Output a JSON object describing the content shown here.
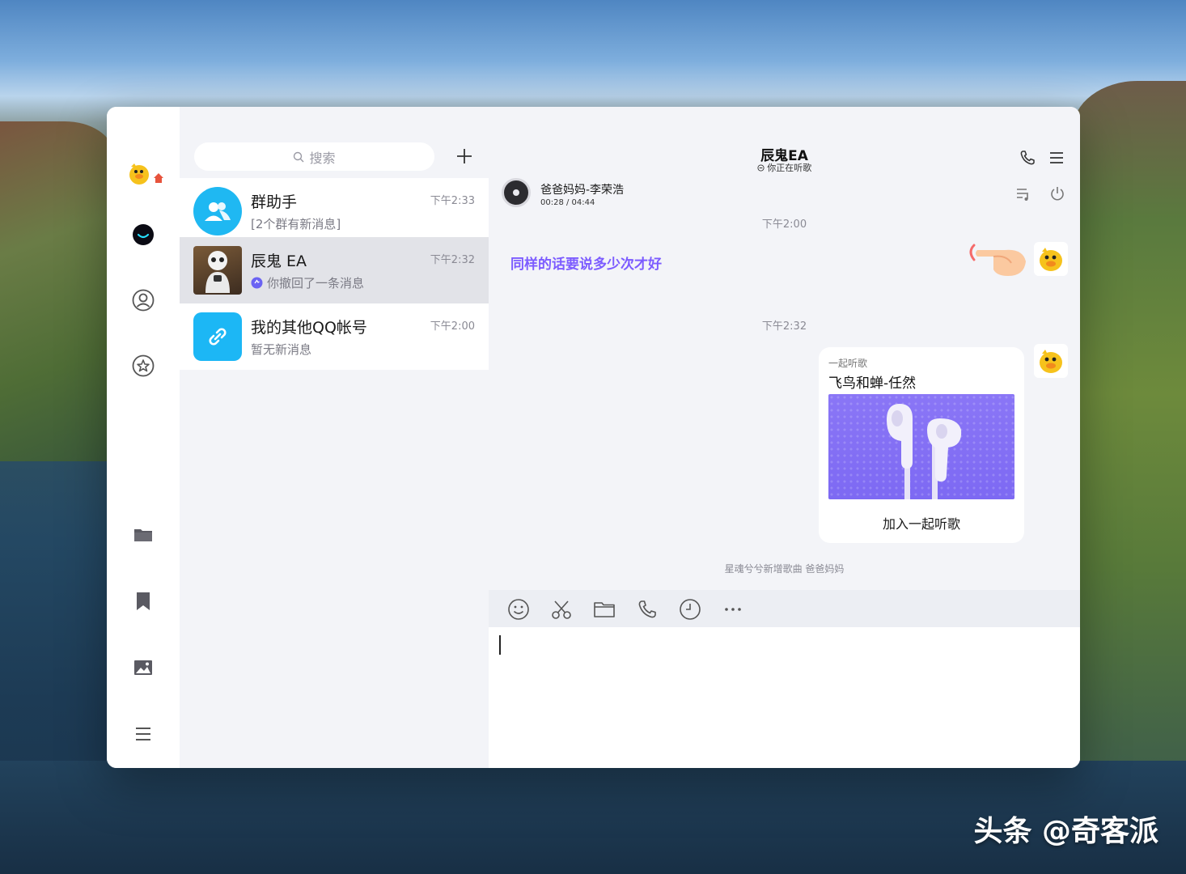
{
  "watermark": "头条 @奇客派",
  "sidebar": {
    "items": [
      {
        "name": "qq-avatar"
      },
      {
        "name": "messages"
      },
      {
        "name": "contacts"
      },
      {
        "name": "discover"
      },
      {
        "name": "files"
      },
      {
        "name": "favorites"
      },
      {
        "name": "photos"
      },
      {
        "name": "menu"
      }
    ]
  },
  "search": {
    "placeholder": "搜索"
  },
  "chats": [
    {
      "name": "群助手",
      "preview": "[2个群有新消息]",
      "time": "下午2:33",
      "avatar_color": "#1fb8f2"
    },
    {
      "name": "辰鬼 EA",
      "preview": "你撤回了一条消息",
      "time": "下午2:32",
      "active": true
    },
    {
      "name": "我的其他QQ帐号",
      "preview": "暂无新消息",
      "time": "下午2:00",
      "avatar_color": "#1cb7f5"
    }
  ],
  "conversation": {
    "title": "辰鬼EA",
    "subtitle": "你正在听歌",
    "music": {
      "song": "爸爸妈妈-李荣浩",
      "time": "00:28 / 04:44"
    },
    "messages": [
      {
        "timestamp": "下午2:00",
        "text": "同样的话要说多少次才好"
      },
      {
        "timestamp": "下午2:32"
      }
    ],
    "card": {
      "tag": "一起听歌",
      "title": "飞鸟和蝉-任然",
      "action": "加入一起听歌"
    },
    "system": "星魂兮兮新增歌曲 爸爸妈妈"
  },
  "colors": {
    "accent": "#7c5cff",
    "card_art": "#8a76f6"
  }
}
